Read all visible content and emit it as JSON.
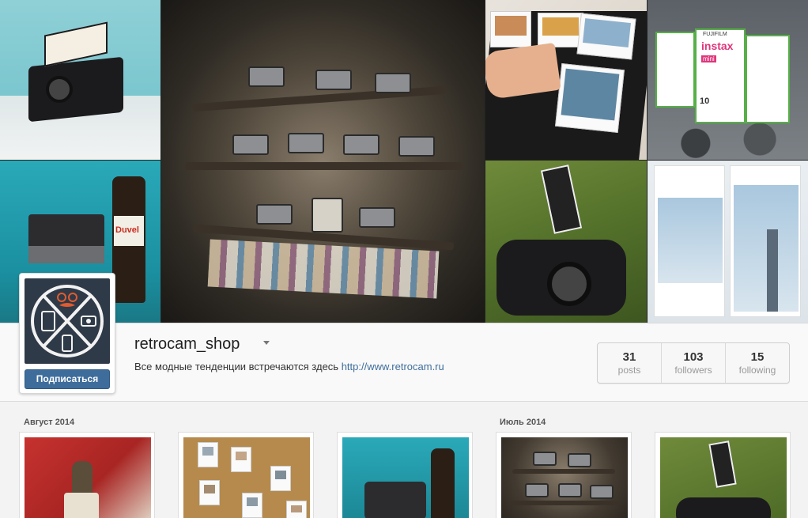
{
  "profile": {
    "username": "retrocam_shop",
    "bio_text": "Все модные тенденции встречаются здесь",
    "bio_link": "http://www.retrocam.ru",
    "follow_label": "Подписаться"
  },
  "stats": [
    {
      "value": "31",
      "label": "posts"
    },
    {
      "value": "103",
      "label": "followers"
    },
    {
      "value": "15",
      "label": "following"
    }
  ],
  "cover_texts": {
    "duvel": "Duvel",
    "instax": "instax",
    "fujifilm": "FUJIFILM",
    "mini": "mini",
    "instax_count": "10"
  },
  "feed": {
    "months": [
      "Август 2014",
      "Июль 2014"
    ]
  },
  "colors": {
    "accent": "#3e6d9c",
    "avatar_bg": "#2f3a48"
  }
}
